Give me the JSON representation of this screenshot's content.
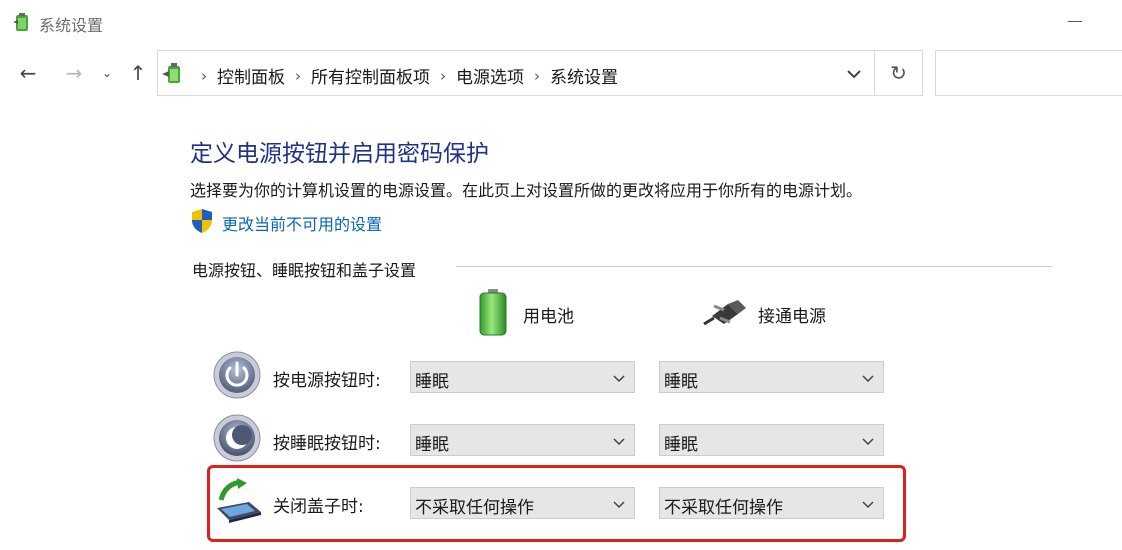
{
  "window": {
    "title": "系统设置"
  },
  "nav": {
    "back_icon": "←",
    "forward_icon": "→",
    "recent_icon": "⌄",
    "up_icon": "↑",
    "refresh_icon": "↻"
  },
  "breadcrumb": {
    "items": [
      "控制面板",
      "所有控制面板项",
      "电源选项",
      "系统设置"
    ],
    "separator": "›"
  },
  "page": {
    "title": "定义电源按钮并启用密码保护",
    "description": "选择要为你的计算机设置的电源设置。在此页上对设置所做的更改将应用于你所有的电源计划。",
    "change_link": "更改当前不可用的设置",
    "section_label": "电源按钮、睡眠按钮和盖子设置"
  },
  "columns": {
    "battery": "用电池",
    "plugged": "接通电源"
  },
  "settings": [
    {
      "label": "按电源按钮时:",
      "battery": "睡眠",
      "plugged": "睡眠",
      "icon": "power-button-icon"
    },
    {
      "label": "按睡眠按钮时:",
      "battery": "睡眠",
      "plugged": "睡眠",
      "icon": "sleep-button-icon"
    },
    {
      "label": "关闭盖子时:",
      "battery": "不采取任何操作",
      "plugged": "不采取任何操作",
      "icon": "laptop-lid-icon"
    }
  ],
  "colors": {
    "title_blue": "#1e3287",
    "link_blue": "#0a66b5",
    "highlight_red": "#e0211b"
  }
}
